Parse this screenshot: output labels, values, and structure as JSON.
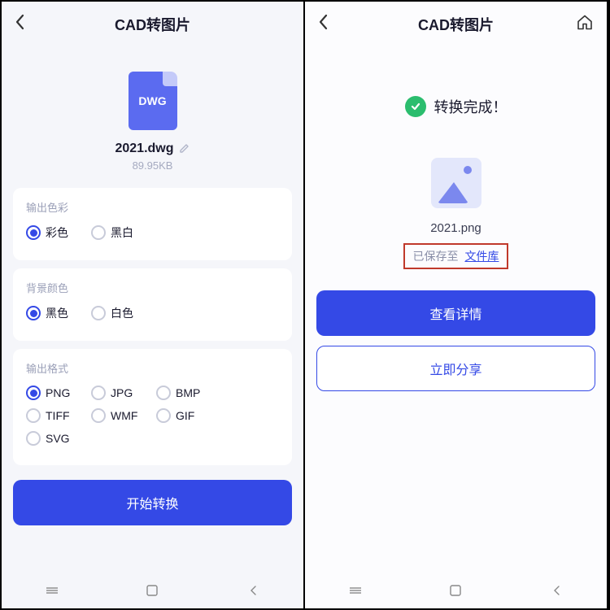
{
  "left": {
    "header": {
      "title": "CAD转图片"
    },
    "file": {
      "badge": "DWG",
      "name": "2021.dwg",
      "size": "89.95KB"
    },
    "sections": {
      "color": {
        "label": "输出色彩",
        "options": [
          "彩色",
          "黑白"
        ],
        "selected": 0
      },
      "bg": {
        "label": "背景颜色",
        "options": [
          "黑色",
          "白色"
        ],
        "selected": 0
      },
      "format": {
        "label": "输出格式",
        "options": [
          "PNG",
          "JPG",
          "BMP",
          "TIFF",
          "WMF",
          "GIF",
          "SVG"
        ],
        "selected": 0
      }
    },
    "action": "开始转换"
  },
  "right": {
    "header": {
      "title": "CAD转图片"
    },
    "success": "转换完成！",
    "output_name": "2021.png",
    "saved_prefix": "已保存至",
    "saved_link": "文件库",
    "view_btn": "查看详情",
    "share_btn": "立即分享"
  }
}
